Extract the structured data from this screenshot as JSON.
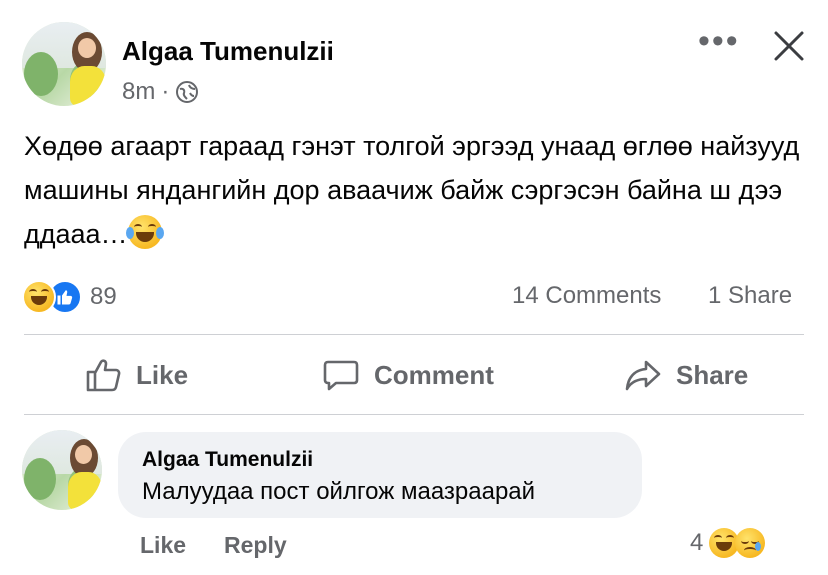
{
  "post": {
    "author": "Algaa Tumenulzii",
    "time": "8m",
    "separator": "·",
    "text": "Хөдөө агаарт гараад гэнэт толгой эргээд унаад өглөө найзууд машины яндангийн дор аваачиж байж сэргэсэн байна ш дээ ддааа…",
    "text_emoji": "laughing-tears-emoji"
  },
  "stats": {
    "reaction_count": "89",
    "comments": "14 Comments",
    "shares": "1 Share"
  },
  "actions": {
    "like": "Like",
    "comment": "Comment",
    "share": "Share"
  },
  "comment": {
    "author": "Algaa Tumenulzii",
    "text": "Малуудаа пост ойлгож маазраарай",
    "like_label": "Like",
    "reply_label": "Reply",
    "reaction_count": "4"
  },
  "colors": {
    "accent": "#1877f2",
    "secondary_text": "#65676b",
    "bubble": "#f0f2f5",
    "divider": "#ced0d4"
  }
}
